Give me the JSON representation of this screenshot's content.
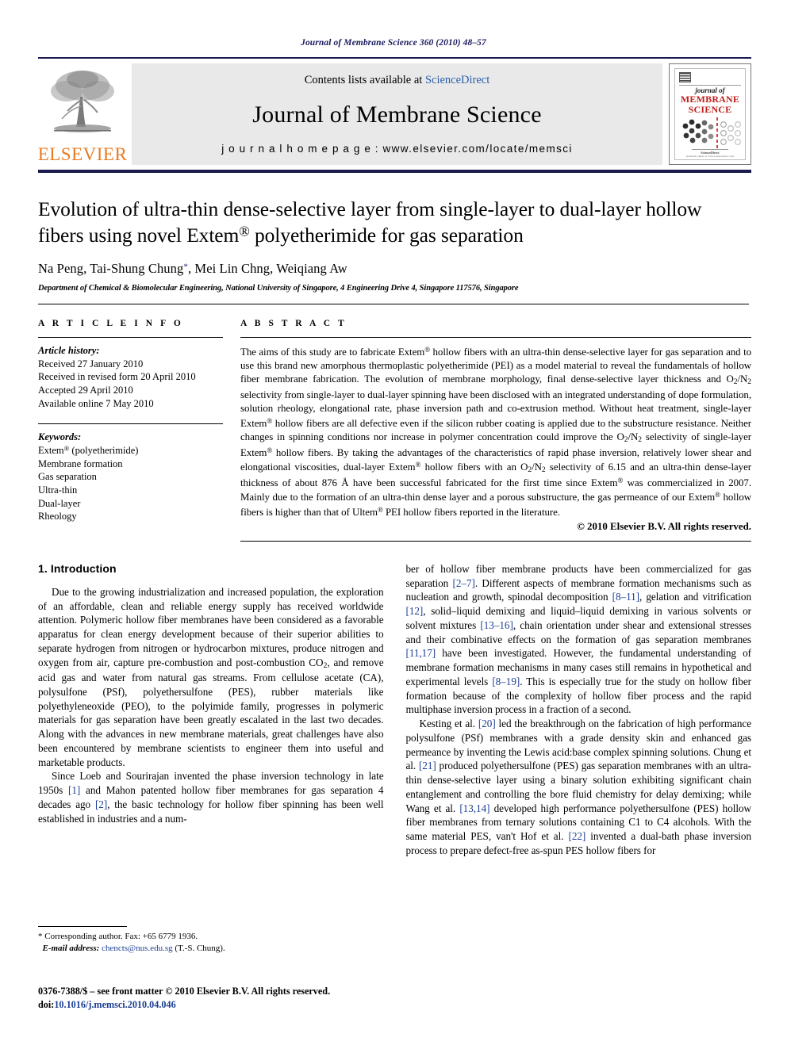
{
  "running_head": "Journal of Membrane Science 360 (2010) 48–57",
  "masthead": {
    "publisher_name": "ELSEVIER",
    "contents_prefix": "Contents lists available at ",
    "sciencedirect": "ScienceDirect",
    "journal_title": "Journal of Membrane Science",
    "homepage_label": "j o u r n a l   h o m e p a g e :  ",
    "homepage_url": "www.elsevier.com/locate/memsci",
    "cover": {
      "line1": "journal of",
      "line2": "MEMBRANE",
      "line3": "SCIENCE",
      "red_hex": "#c0201c"
    }
  },
  "article": {
    "title": "Evolution of ultra-thin dense-selective layer from single-layer to dual-layer hollow fibers using novel Extem® polyetherimide for gas separation",
    "authors": "Na Peng, Tai-Shung Chung*, Mei Lin Chng, Weiqiang Aw",
    "affiliation": "Department of Chemical & Biomolecular Engineering, National University of Singapore, 4 Engineering Drive 4, Singapore 117576, Singapore"
  },
  "article_info": {
    "label": "A R T I C L E   I N F O",
    "history_heading": "Article history:",
    "history": [
      "Received 27 January 2010",
      "Received in revised form 20 April 2010",
      "Accepted 29 April 2010",
      "Available online 7 May 2010"
    ],
    "keywords_heading": "Keywords:",
    "keywords": [
      "Extem® (polyetherimide)",
      "Membrane formation",
      "Gas separation",
      "Ultra-thin",
      "Dual-layer",
      "Rheology"
    ]
  },
  "abstract": {
    "label": "A B S T R A C T",
    "text": "The aims of this study are to fabricate Extem® hollow fibers with an ultra-thin dense-selective layer for gas separation and to use this brand new amorphous thermoplastic polyetherimide (PEI) as a model material to reveal the fundamentals of hollow fiber membrane fabrication. The evolution of membrane morphology, final dense-selective layer thickness and O2/N2 selectivity from single-layer to dual-layer spinning have been disclosed with an integrated understanding of dope formulation, solution rheology, elongational rate, phase inversion path and co-extrusion method. Without heat treatment, single-layer Extem® hollow fibers are all defective even if the silicon rubber coating is applied due to the substructure resistance. Neither changes in spinning conditions nor increase in polymer concentration could improve the O2/N2 selectivity of single-layer Extem® hollow fibers. By taking the advantages of the characteristics of rapid phase inversion, relatively lower shear and elongational viscosities, dual-layer Extem® hollow fibers with an O2/N2 selectivity of 6.15 and an ultra-thin dense-layer thickness of about 876 Å have been successful fabricated for the first time since Extem® was commercialized in 2007. Mainly due to the formation of an ultra-thin dense layer and a porous substructure, the gas permeance of our Extem® hollow fibers is higher than that of Ultem® PEI hollow fibers reported in the literature.",
    "copyright": "© 2010 Elsevier B.V. All rights reserved."
  },
  "body": {
    "section_number_title": "1.  Introduction",
    "left_paragraphs": [
      "Due to the growing industrialization and increased population, the exploration of an affordable, clean and reliable energy supply has received worldwide attention. Polymeric hollow fiber membranes have been considered as a favorable apparatus for clean energy development because of their superior abilities to separate hydrogen from nitrogen or hydrocarbon mixtures, produce nitrogen and oxygen from air, capture pre-combustion and post-combustion CO2, and remove acid gas and water from natural gas streams. From cellulose acetate (CA), polysulfone (PSf), polyethersulfone (PES), rubber materials like polyethyleneoxide (PEO), to the polyimide family, progresses in polymeric materials for gas separation have been greatly escalated in the last two decades. Along with the advances in new membrane materials, great challenges have also been encountered by membrane scientists to engineer them into useful and marketable products.",
      "Since Loeb and Sourirajan invented the phase inversion technology in late 1950s [1] and Mahon patented hollow fiber membranes for gas separation 4 decades ago [2], the basic technology for hollow fiber spinning has been well established in industries and a num-"
    ],
    "right_paragraphs": [
      "ber of hollow fiber membrane products have been commercialized for gas separation [2–7]. Different aspects of membrane formation mechanisms such as nucleation and growth, spinodal decomposition [8–11], gelation and vitrification [12], solid–liquid demixing and liquid–liquid demixing in various solvents or solvent mixtures [13–16], chain orientation under shear and extensional stresses and their combinative effects on the formation of gas separation membranes [11,17] have been investigated. However, the fundamental understanding of membrane formation mechanisms in many cases still remains in hypothetical and experimental levels [8–19]. This is especially true for the study on hollow fiber formation because of the complexity of hollow fiber process and the rapid multiphase inversion process in a fraction of a second.",
      "Kesting et al. [20] led the breakthrough on the fabrication of high performance polysulfone (PSf) membranes with a grade density skin and enhanced gas permeance by inventing the Lewis acid:base complex spinning solutions. Chung et al. [21] produced polyethersulfone (PES) gas separation membranes with an ultra-thin dense-selective layer using a binary solution exhibiting significant chain entanglement and controlling the bore fluid chemistry for delay demixing; while Wang et al. [13,14] developed high performance polyethersulfone (PES) hollow fiber membranes from ternary solutions containing C1 to C4 alcohols. With the same material PES, van't Hof et al. [22] invented a dual-bath phase inversion process to prepare defect-free as-spun PES hollow fibers for"
    ]
  },
  "footnote": {
    "corresponding": "* Corresponding author. Fax: +65 6779 1936.",
    "email_label": "E-mail address:",
    "email": "chencts@nus.edu.sg",
    "email_suffix": " (T.-S. Chung)."
  },
  "footer": {
    "issn_line": "0376-7388/$ – see front matter © 2010 Elsevier B.V. All rights reserved.",
    "doi_label": "doi:",
    "doi": "10.1016/j.memsci.2010.04.046"
  }
}
